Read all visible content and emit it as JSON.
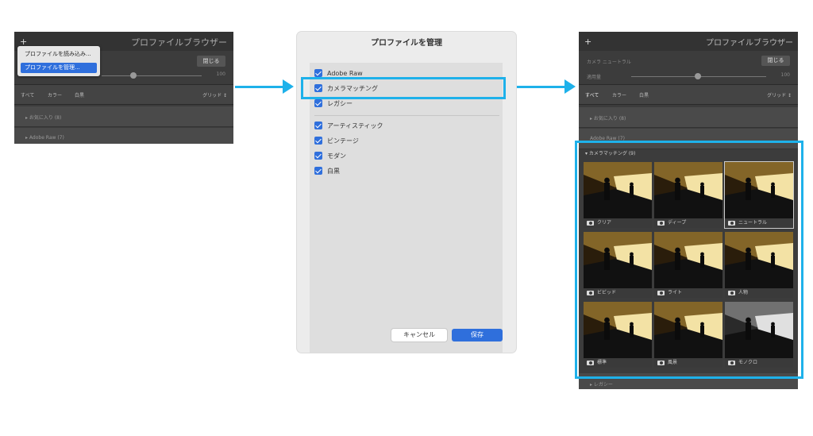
{
  "colors": {
    "accent": "#1eb1ea",
    "select": "#2f6fdc"
  },
  "left_panel": {
    "plus": "+",
    "title": "プロファイルブラウザー",
    "menu": [
      "プロファイルを読み込み...",
      "プロファイルを管理..."
    ],
    "close": "閉じる",
    "amount": "100",
    "filters": [
      "すべて",
      "カラー",
      "白黒"
    ],
    "view": "グリッド ↕",
    "groups": [
      "▸ お気に入り (8)",
      "▸ Adobe Raw (7)"
    ]
  },
  "dialog": {
    "title": "プロファイルを管理",
    "items_top": [
      {
        "label": "Adobe Raw",
        "checked": true
      },
      {
        "label": "カメラマッチング",
        "checked": true
      },
      {
        "label": "レガシー",
        "checked": true
      }
    ],
    "items_bottom": [
      {
        "label": "アーティスティック",
        "checked": true
      },
      {
        "label": "ビンテージ",
        "checked": true
      },
      {
        "label": "モダン",
        "checked": true
      },
      {
        "label": "白黒",
        "checked": true
      }
    ],
    "cancel": "キャンセル",
    "save": "保存"
  },
  "right_panel": {
    "plus": "+",
    "title": "プロファイルブラウザー",
    "profile": "カメラ ニュートラル",
    "close": "閉じる",
    "amount_label": "適用量",
    "amount": "100",
    "filters": [
      "すべて",
      "カラー",
      "白黒"
    ],
    "view": "グリッド ↕",
    "groups": [
      "▸ お気に入り (8)",
      "Adobe Raw (7)"
    ],
    "camera_group": "▾ カメラマッチング (9)",
    "thumbnails": [
      {
        "label": "クリア",
        "tone": "color"
      },
      {
        "label": "ディープ",
        "tone": "color"
      },
      {
        "label": "ニュートラル",
        "tone": "color",
        "selected": true
      },
      {
        "label": "ビビッド",
        "tone": "color"
      },
      {
        "label": "ライト",
        "tone": "color"
      },
      {
        "label": "人物",
        "tone": "color"
      },
      {
        "label": "標準",
        "tone": "color"
      },
      {
        "label": "風景",
        "tone": "color"
      },
      {
        "label": "モノクロ",
        "tone": "mono"
      }
    ],
    "footer": "▸ レガシー"
  }
}
